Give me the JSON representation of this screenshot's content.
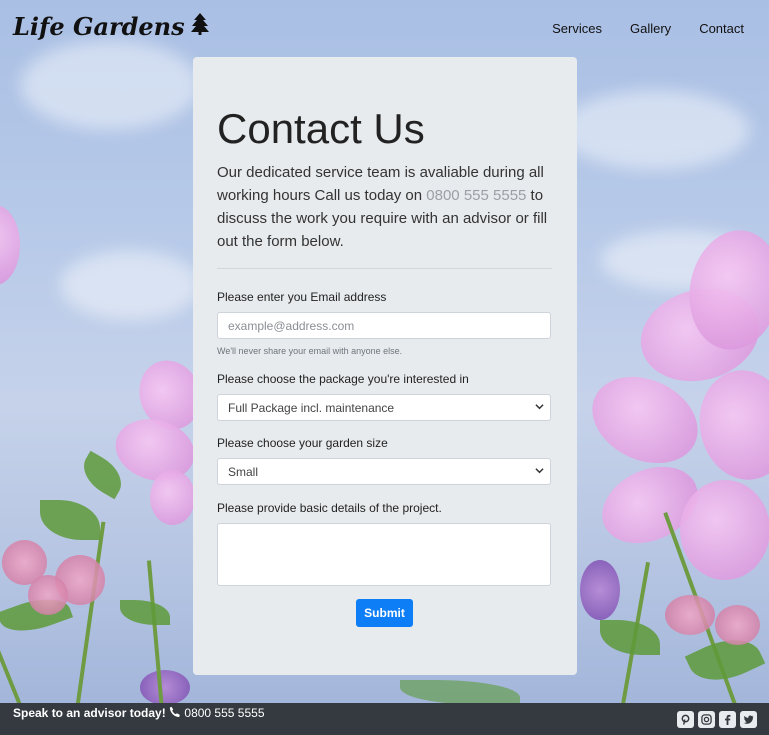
{
  "header": {
    "logo": "Life Gardens",
    "logo_icon": "tree-icon",
    "nav": [
      "Services",
      "Gallery",
      "Contact"
    ]
  },
  "card": {
    "title": "Contact Us",
    "intro_before": "Our dedicated service team is avaliable during all working hours Call us today on ",
    "intro_phone": "0800 555 5555",
    "intro_after": " to discuss the work you require with an advisor or fill out the form below."
  },
  "form": {
    "email_label": "Please enter you Email address",
    "email_placeholder": "example@address.com",
    "email_value": "",
    "email_hint": "We'll never share your email with anyone else.",
    "package_label": "Please choose the package you're interested in",
    "package_selected": "Full Package incl. maintenance",
    "size_label": "Please choose your garden size",
    "size_selected": "Small",
    "details_label": "Please provide basic details of the project.",
    "details_value": "",
    "submit_label": "Submit"
  },
  "footer": {
    "cta": "Speak to an advisor today!",
    "phone_icon": "phone-icon",
    "phone": "0800 555 5555",
    "socials": [
      "pinterest-icon",
      "instagram-icon",
      "facebook-icon",
      "twitter-icon"
    ]
  },
  "colors": {
    "card_bg": "#e8ebee",
    "button": "#0d7ef6",
    "footer_bg": "#343a40",
    "phone_link": "#9aa0a6"
  }
}
